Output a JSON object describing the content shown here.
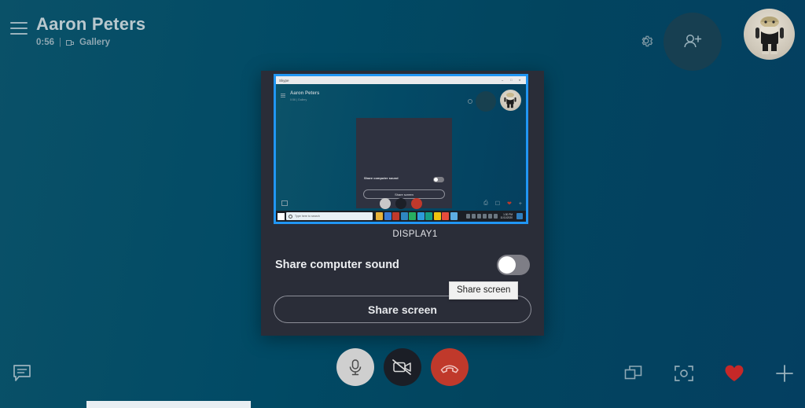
{
  "header": {
    "menu_icon": "hamburger-icon",
    "title": "Aaron Peters",
    "duration": "0:56",
    "separator": "|",
    "layout_mode": "Gallery",
    "gear_icon": "gear-icon",
    "add_person_icon": "add-person-icon",
    "avatar_label": "avatar"
  },
  "share_dialog": {
    "display_label": "DISPLAY1",
    "sound_label": "Share computer sound",
    "sound_toggle_state": "off",
    "share_button_label": "Share screen",
    "tooltip_text": "Share screen",
    "selection_border_color": "#2196f3",
    "panel_color": "#2a2d38"
  },
  "thumbnail": {
    "window_title": "Skype",
    "minimize": "–",
    "maximize": "□",
    "close": "×",
    "title": "Aaron Peters",
    "sub": "0:56 | Gallery",
    "inner_sound_label": "Share computer sound",
    "inner_share_button_label": "Share screen",
    "taskbar_search_placeholder": "Type here to search",
    "taskbar_clock_time": "1:30 PM",
    "taskbar_clock_date": "11/11/2020",
    "taskbar_app_colors": [
      "#e8b33a",
      "#3a7bd5",
      "#c0392b",
      "#2e86c1",
      "#27ae60",
      "#2d9cdb",
      "#16a085",
      "#f1c40f",
      "#e74c3c",
      "#5dade2"
    ]
  },
  "bottom_bar": {
    "chat_icon": "chat-bubble-icon",
    "mic_icon": "microphone-icon",
    "mic_state": "on",
    "camera_icon": "camera-off-icon",
    "camera_state": "off",
    "end_call_icon": "end-call-icon",
    "screen_share_icon": "screen-share-icon",
    "snapshot_icon": "snapshot-icon",
    "reaction_icon": "heart-icon",
    "reaction_color": "#c62828",
    "more_icon": "plus-icon"
  },
  "colors": {
    "background_left": "#0a5168",
    "background_right": "#043f61",
    "dialog": "#2a2d38",
    "accent_blue": "#2196f3",
    "danger_red": "#c0392b"
  }
}
